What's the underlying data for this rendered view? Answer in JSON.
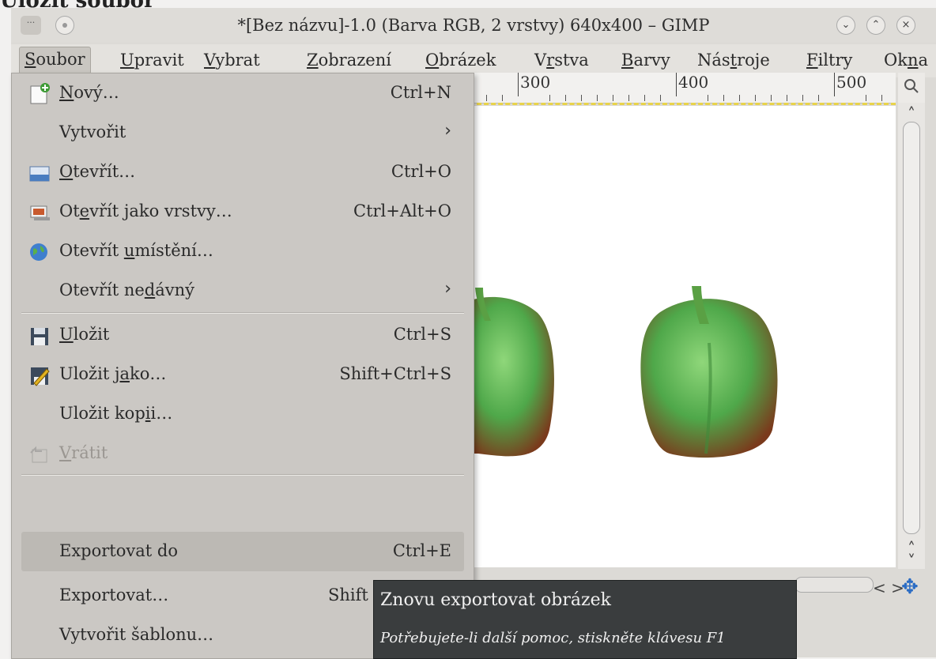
{
  "caption": "Uložit soubor",
  "window": {
    "title": "*[Bez názvu]-1.0 (Barva RGB, 2 vrstvy) 640x400 – GIMP",
    "menu_glyph": "···",
    "minimize_glyph": "⌄",
    "maximize_glyph": "⌃",
    "close_glyph": "×"
  },
  "menubar": [
    {
      "u": "S",
      "rest": "oubor"
    },
    {
      "u": "U",
      "rest": "pravit"
    },
    {
      "u": "V",
      "rest": "ybrat"
    },
    {
      "u": "Z",
      "rest": "obrazení"
    },
    {
      "u": "O",
      "rest": "brázek"
    },
    {
      "pre": "V",
      "u": "r",
      "rest": "stva"
    },
    {
      "u": "B",
      "rest": "arvy"
    },
    {
      "pre": "Nás",
      "u": "t",
      "rest": "roje"
    },
    {
      "u": "F",
      "rest": "iltry"
    },
    {
      "pre": "Ok",
      "u": "n",
      "rest": "a"
    }
  ],
  "ruler": {
    "labels": [
      "300",
      "400",
      "500"
    ],
    "corner_icon": "zoom-icon"
  },
  "file_menu": {
    "items": [
      {
        "icon": "new-icon",
        "label_pre": "",
        "label_u": "N",
        "label_post": "ový…",
        "shortcut": "Ctrl+N"
      },
      {
        "icon": "",
        "label_pre": "Vytvořit",
        "label_u": "",
        "label_post": "",
        "submenu": true
      },
      {
        "icon": "open-icon",
        "label_pre": "",
        "label_u": "O",
        "label_post": "tevřít…",
        "shortcut": "Ctrl+O"
      },
      {
        "icon": "open-as-layers-icon",
        "label_pre": "Ot",
        "label_u": "e",
        "label_post": "vřít jako vrstvy…",
        "shortcut": "Ctrl+Alt+O"
      },
      {
        "icon": "globe-icon",
        "label_pre": "Otevřít ",
        "label_u": "u",
        "label_post": "místění…"
      },
      {
        "icon": "",
        "label_pre": "Otevřít ne",
        "label_u": "d",
        "label_post": "ávný",
        "submenu": true
      },
      {
        "icon": "save-icon",
        "label_pre": "",
        "label_u": "U",
        "label_post": "ložit",
        "shortcut": "Ctrl+S"
      },
      {
        "icon": "save-as-icon",
        "label_pre": "Uložit j",
        "label_u": "a",
        "label_post": "ko…",
        "shortcut": "Shift+Ctrl+S"
      },
      {
        "icon": "",
        "label_pre": "Uložit kop",
        "label_u": "i",
        "label_post": "i…"
      },
      {
        "icon": "revert-icon",
        "label_pre": "",
        "label_u": "V",
        "label_post": "rátit",
        "disabled": true
      },
      {
        "icon": "",
        "label_pre": "Exportovat do",
        "label_u": "",
        "label_post": "",
        "shortcut": "Ctrl+E",
        "highlighted": true
      },
      {
        "icon": "",
        "label_pre": "Exportovat…",
        "label_u": "",
        "label_post": "",
        "shortcut": "Shift"
      },
      {
        "icon": "",
        "label_pre": "Vytvořit šablonu…",
        "label_u": "",
        "label_post": ""
      }
    ]
  },
  "tooltip": {
    "title": "Znovu exportovat obrázek",
    "help": "Potřebujete-li další pomoc, stiskněte klávesu F1"
  },
  "navigation": {
    "arrows": "< >",
    "move": "✥"
  }
}
